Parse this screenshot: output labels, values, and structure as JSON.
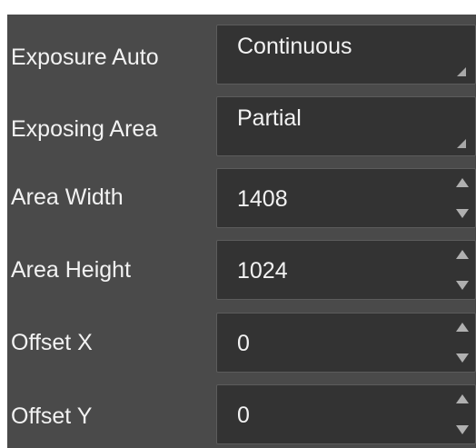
{
  "properties": [
    {
      "label": "Exposure Auto",
      "value": "Continuous",
      "control": "dropdown"
    },
    {
      "label": "Exposing Area",
      "value": "Partial",
      "control": "dropdown"
    },
    {
      "label": "Area Width",
      "value": "1408",
      "control": "spinbox"
    },
    {
      "label": "Area Height",
      "value": "1024",
      "control": "spinbox"
    },
    {
      "label": "Offset X",
      "value": "0",
      "control": "spinbox"
    },
    {
      "label": "Offset Y",
      "value": "0",
      "control": "spinbox"
    }
  ],
  "colors": {
    "panel_background": "#4a4a4a",
    "field_background": "#333333",
    "text": "#f2f2f2"
  }
}
